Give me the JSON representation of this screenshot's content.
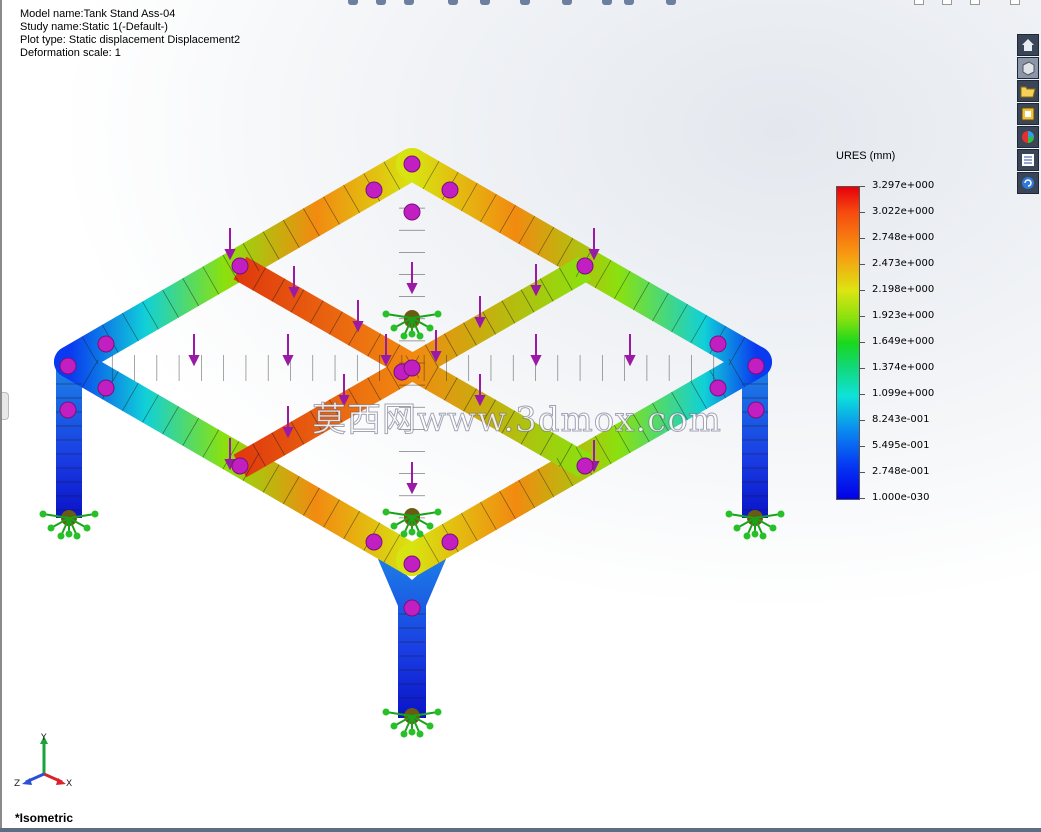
{
  "info": {
    "model": "Model name:Tank Stand Ass-04",
    "study": "Study name:Static 1(-Default-)",
    "plot": "Plot type: Static displacement Displacement2",
    "scale": "Deformation scale: 1"
  },
  "legend": {
    "title": "URES (mm)",
    "labels": [
      "3.297e+000",
      "3.022e+000",
      "2.748e+000",
      "2.473e+000",
      "2.198e+000",
      "1.923e+000",
      "1.649e+000",
      "1.374e+000",
      "1.099e+000",
      "8.243e-001",
      "5.495e-001",
      "2.748e-001",
      "1.000e-030"
    ],
    "colors": {
      "max": "#e8000c",
      "mid": "#18d81e",
      "min": "#0400e6"
    }
  },
  "view": {
    "name": "*Isometric"
  },
  "triad": {
    "x": "X",
    "y": "Y",
    "z": "Z"
  },
  "watermark": "莫西网www.3dmox.com",
  "toolbar": {
    "items": [
      {
        "icon": "home-icon"
      },
      {
        "icon": "view-cube-icon"
      },
      {
        "icon": "folder-icon"
      },
      {
        "icon": "design-library-icon"
      },
      {
        "icon": "appearance-icon"
      },
      {
        "icon": "properties-list-icon"
      },
      {
        "icon": "refresh-icon"
      }
    ]
  }
}
